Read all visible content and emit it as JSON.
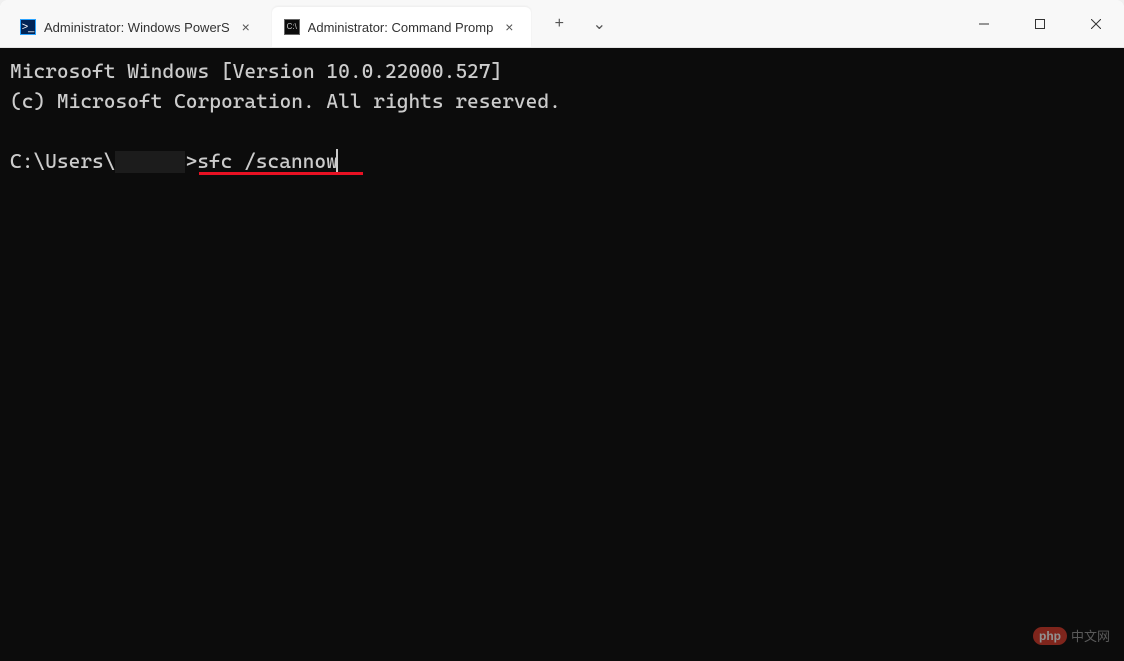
{
  "tabs": [
    {
      "title": "Administrator: Windows PowerS",
      "active": false,
      "icon": "ps-icon"
    },
    {
      "title": "Administrator: Command Promp",
      "active": true,
      "icon": "cmd-icon"
    }
  ],
  "terminal": {
    "line1": "Microsoft Windows [Version 10.0.22000.527]",
    "line2": "(c) Microsoft Corporation. All rights reserved.",
    "prompt_prefix": "C:\\Users\\",
    "prompt_suffix": ">",
    "command": "sfc /scannow"
  },
  "watermark": {
    "logo": "php",
    "text": "中文网"
  },
  "icons": {
    "new_tab": "+",
    "tab_dropdown": "⌄",
    "close_tab": "×",
    "ps_label": ">_",
    "cmd_label": "C:\\"
  }
}
